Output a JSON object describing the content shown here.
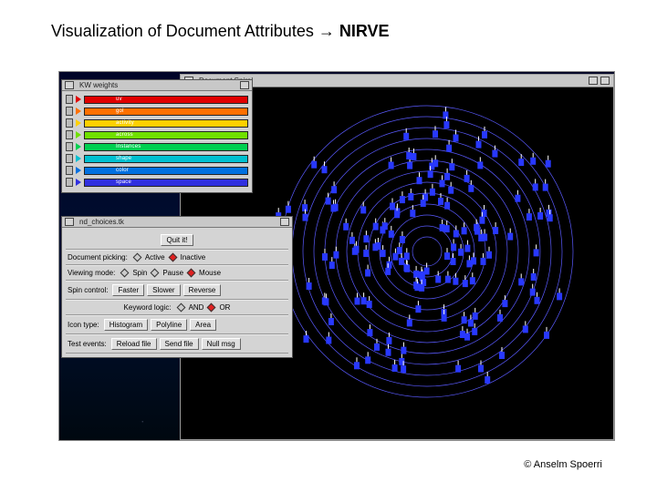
{
  "slide": {
    "title_prefix": "Visualization of Document Attributes ",
    "title_arrow": "→",
    "title_suffix": " NIRVE",
    "copyright": "© Anselm Spoerri"
  },
  "windows": {
    "spiral_title": "Document Spiral",
    "kw_title": "KW weights",
    "ctrl_title": "nd_choices.tk"
  },
  "keywords": [
    {
      "label": "uv",
      "color": "#e00000"
    },
    {
      "label": "gol",
      "color": "#ff7000"
    },
    {
      "label": "activity",
      "color": "#ffd000"
    },
    {
      "label": "across",
      "color": "#70e000"
    },
    {
      "label": "Instances",
      "color": "#00d050"
    },
    {
      "label": "shape",
      "color": "#00c0d0"
    },
    {
      "label": "color",
      "color": "#0070e0"
    },
    {
      "label": "space",
      "color": "#3030e0"
    }
  ],
  "controls": {
    "quit": "Quit it!",
    "doc_picking_label": "Document picking:",
    "active": "Active",
    "inactive": "Inactive",
    "viewing_label": "Viewing mode:",
    "spin": "Spin",
    "pause": "Pause",
    "mouse": "Mouse",
    "spin_ctrl_label": "Spin control:",
    "faster": "Faster",
    "slower": "Slower",
    "reverse": "Reverse",
    "kw_logic_label": "Keyword logic:",
    "and": "AND",
    "or": "OR",
    "icon_type_label": "Icon type:",
    "histogram": "Histogram",
    "polyline": "Polyline",
    "area": "Area",
    "test_label": "Test events:",
    "reload": "Reload file",
    "send": "Send file",
    "nullmsg": "Null msg"
  }
}
